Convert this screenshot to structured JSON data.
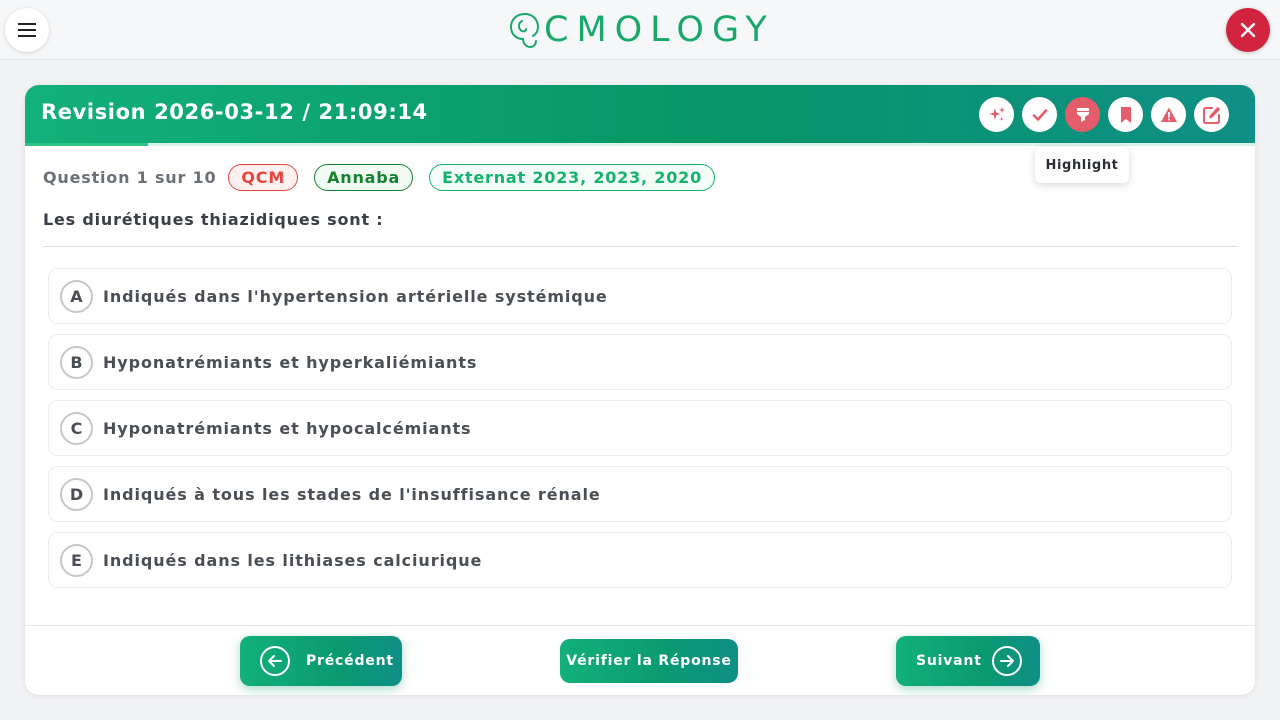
{
  "app": {
    "logo_text": "CMOLOGY",
    "brand_color": "#1aa86a",
    "close_color": "#d2233f"
  },
  "header": {
    "title": "Revision 2026-03-12 / 21:09:14",
    "tools": [
      {
        "name": "sparkle-icon",
        "active": false
      },
      {
        "name": "check-icon",
        "active": false
      },
      {
        "name": "highlight-icon",
        "active": true
      },
      {
        "name": "bookmark-icon",
        "active": false
      },
      {
        "name": "warning-icon",
        "active": false
      },
      {
        "name": "edit-note-icon",
        "active": false
      }
    ],
    "tooltip": "Highlight"
  },
  "meta": {
    "question_count": "Question 1 sur 10",
    "type_badge": "QCM",
    "city_badge": "Annaba",
    "exam_badge": "Externat 2023, 2023, 2020"
  },
  "question": {
    "text": "Les diurétiques thiazidiques sont :"
  },
  "options": [
    {
      "letter": "A",
      "text": "Indiqués dans l'hypertension artérielle systémique"
    },
    {
      "letter": "B",
      "text": "Hyponatrémiants et hyperkaliémiants"
    },
    {
      "letter": "C",
      "text": "Hyponatrémiants et hypocalcémiants"
    },
    {
      "letter": "D",
      "text": "Indiqués à tous les stades de l'insuffisance rénale"
    },
    {
      "letter": "E",
      "text": "Indiqués dans les lithiases calciurique"
    }
  ],
  "footer": {
    "prev_label": "Précédent",
    "check_label": "Vérifier la Réponse",
    "next_label": "Suivant"
  }
}
